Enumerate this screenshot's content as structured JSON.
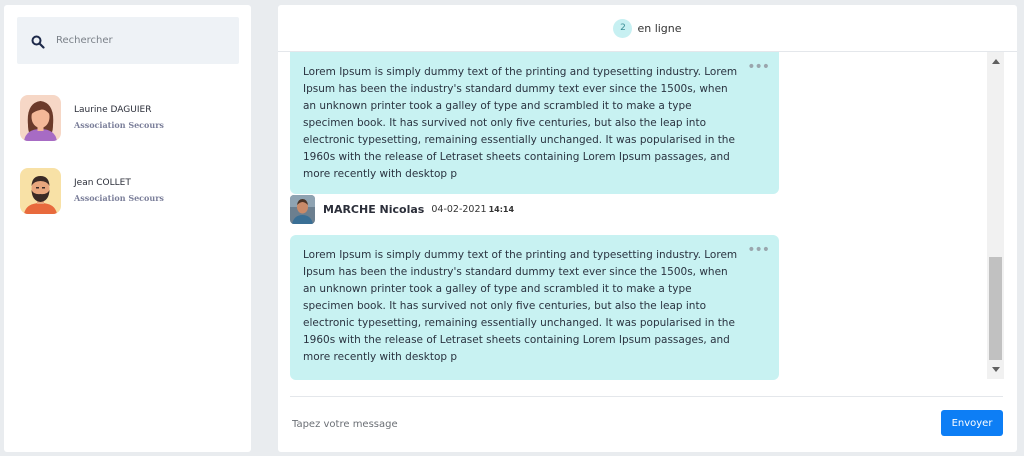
{
  "search": {
    "placeholder": "Rechercher",
    "icon": "search-icon"
  },
  "contacts": [
    {
      "name": "Laurine DAGUIER",
      "organization": "Association Secours",
      "avatar": "female-avatar"
    },
    {
      "name": "Jean COLLET",
      "organization": "Association Secours",
      "avatar": "male-bearded-avatar"
    }
  ],
  "header": {
    "online_count": "2",
    "online_label": "en ligne"
  },
  "messages": [
    {
      "text": "Lorem Ipsum is simply dummy text of the printing and typesetting industry. Lorem Ipsum has been the industry's standard dummy text ever since the 1500s, when an unknown printer took a galley of type and scrambled it to make a type specimen book. It has survived not only five centuries, but also the leap into electronic typesetting, remaining essentially unchanged. It was popularised in the 1960s with the release of Letraset sheets containing Lorem Ipsum passages, and more recently with desktop p",
      "menu": "•••"
    },
    {
      "sender": "MARCHE Nicolas",
      "date": "04-02-2021",
      "time": "14:14",
      "text": "Lorem Ipsum is simply dummy text of the printing and typesetting industry. Lorem Ipsum has been the industry's standard dummy text ever since the 1500s, when an unknown printer took a galley of type and scrambled it to make a type specimen book. It has survived not only five centuries, but also the leap into electronic typesetting, remaining essentially unchanged. It was popularised in the 1960s with the release of Letraset sheets containing Lorem Ipsum passages, and more recently with desktop p",
      "menu": "•••"
    }
  ],
  "composer": {
    "placeholder": "Tapez votre message",
    "send_label": "Envoyer"
  },
  "colors": {
    "bubble": "#c8f2f2",
    "send_button": "#0d7ef5",
    "online_badge": "#c7f0f2"
  }
}
